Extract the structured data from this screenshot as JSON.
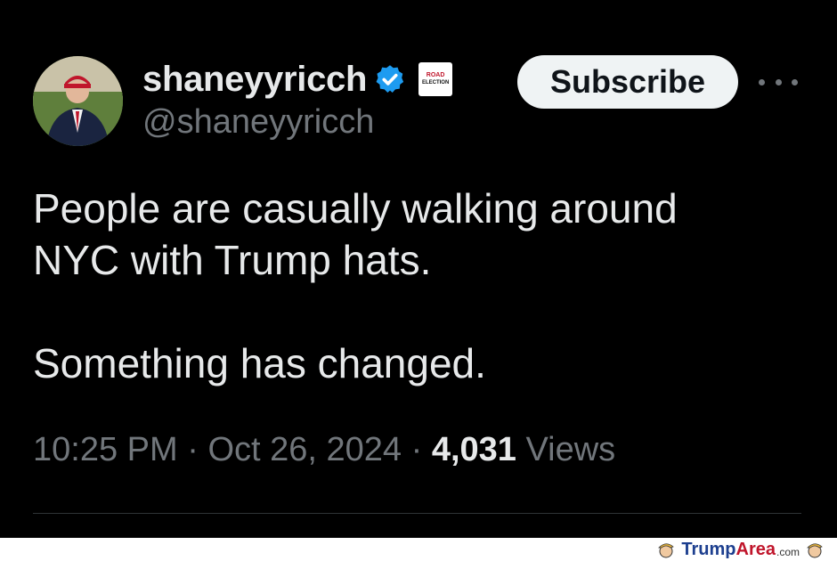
{
  "tweet": {
    "display_name": "shaneyyricch",
    "handle": "@shaneyyricch",
    "affiliation_badge": {
      "line1": "ROAD",
      "line2": "ELECTION"
    },
    "subscribe_label": "Subscribe",
    "text_lines": [
      "People are casually walking around",
      "NYC with Trump hats.",
      "Something has changed."
    ],
    "time": "10:25 PM",
    "separator": "·",
    "date": "Oct 26, 2024",
    "views_count": "4,031",
    "views_label": "Views"
  },
  "watermark": {
    "part1": "Trump",
    "part2": "Area",
    "tld": ".com"
  },
  "colors": {
    "background": "#000000",
    "verified": "#1d9bf0",
    "muted": "#71767b",
    "text": "#e7e9ea"
  },
  "icons": {
    "verified": "verified-badge-icon",
    "more": "more-icon"
  }
}
